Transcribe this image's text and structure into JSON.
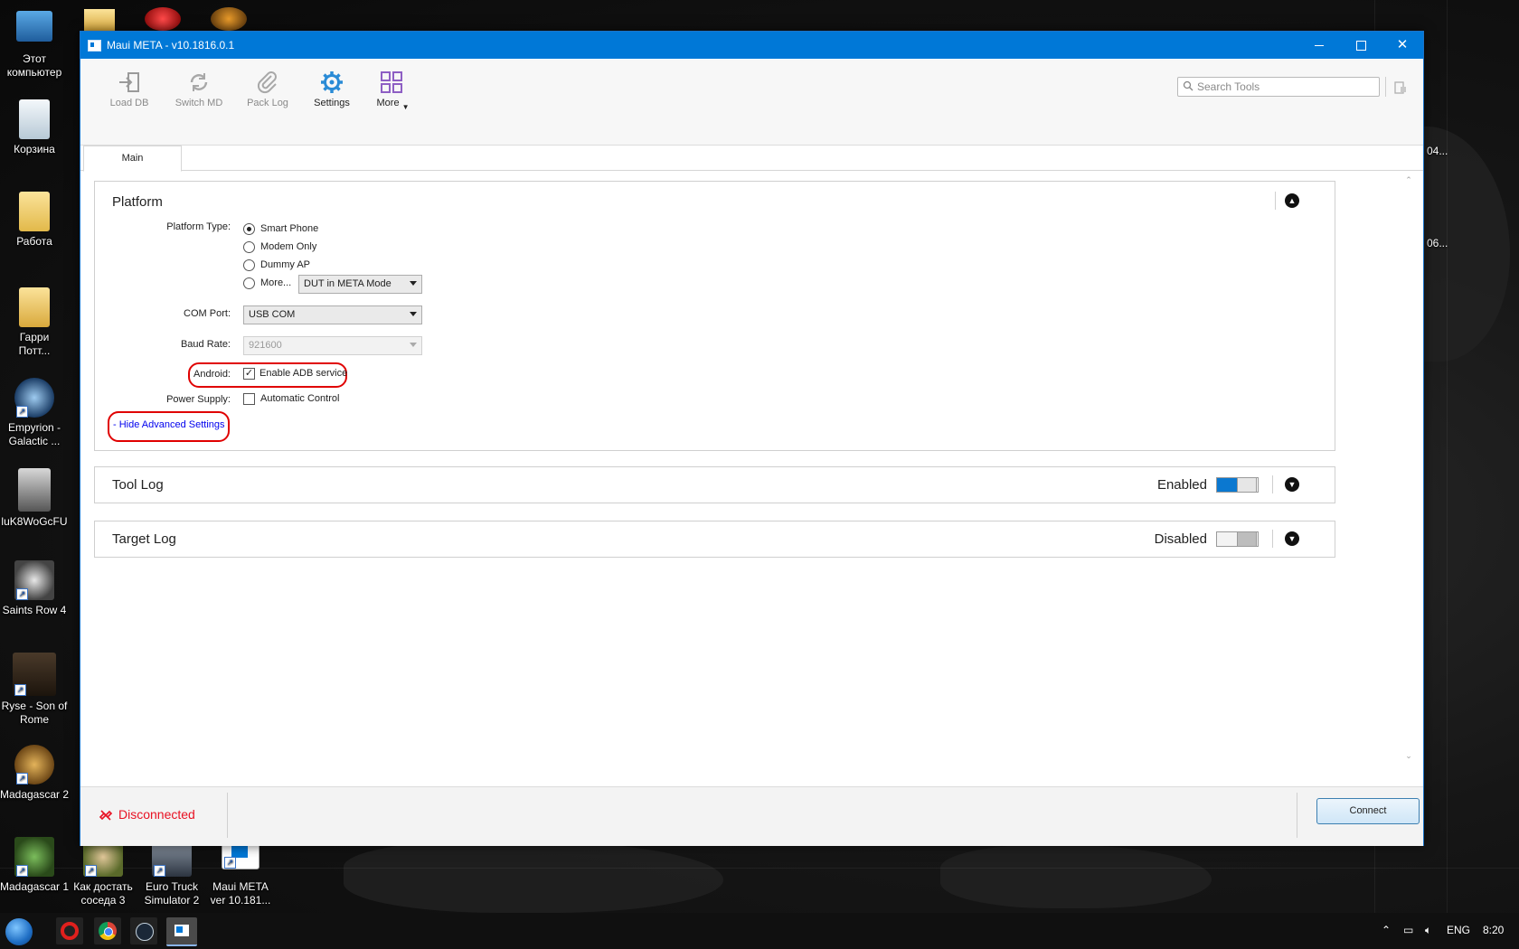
{
  "desktop": {
    "icons": [
      {
        "label": "Этот компьютер"
      },
      {
        "label": "Корзина"
      },
      {
        "label": "Работа"
      },
      {
        "label": "Гарри Потт..."
      },
      {
        "label": "Empyrion - Galactic ..."
      },
      {
        "label": "luK8WoGcFU"
      },
      {
        "label": "Saints Row 4"
      },
      {
        "label": "Ryse - Son of Rome"
      },
      {
        "label": "Madagascar 2"
      },
      {
        "label": "Madagascar 1"
      },
      {
        "label": "Как достать соседа 3"
      },
      {
        "label": "Euro Truck Simulator 2"
      },
      {
        "label": "Maui META ver 10.181..."
      }
    ],
    "right_labels": [
      "04...",
      "06..."
    ]
  },
  "window": {
    "title": "Maui META - v10.1816.0.1"
  },
  "toolbar": {
    "buttons": [
      {
        "label": "Load DB",
        "icon": "load-db-icon"
      },
      {
        "label": "Switch MD",
        "icon": "switch-md-icon"
      },
      {
        "label": "Pack Log",
        "icon": "paperclip-icon"
      },
      {
        "label": "Settings",
        "icon": "gear-icon"
      },
      {
        "label": "More",
        "icon": "grid-icon"
      }
    ],
    "search_placeholder": "Search Tools"
  },
  "tabs": [
    {
      "label": "Main"
    }
  ],
  "platform": {
    "title": "Platform",
    "platform_type_label": "Platform Type:",
    "options": [
      "Smart Phone",
      "Modem Only",
      "Dummy AP",
      "More..."
    ],
    "selected_option": "Smart Phone",
    "more_select": "DUT in META Mode",
    "com_port_label": "COM Port:",
    "com_port_value": "USB COM",
    "baud_rate_label": "Baud Rate:",
    "baud_rate_value": "921600",
    "android_label": "Android:",
    "adb_label": "Enable ADB service",
    "adb_checked": true,
    "power_label": "Power Supply:",
    "power_option": "Automatic Control",
    "power_checked": false,
    "advanced_link": "- Hide Advanced Settings"
  },
  "tool_log": {
    "title": "Tool Log",
    "state": "Enabled",
    "on": true
  },
  "target_log": {
    "title": "Target Log",
    "state": "Disabled",
    "on": false
  },
  "status": {
    "text": "Disconnected",
    "connect_label": "Connect"
  },
  "taskbar": {
    "lang": "ENG",
    "time": "8:20"
  },
  "colors": {
    "accent": "#0078d7",
    "status_red": "#e81123",
    "toggle_on": "#0b78d0",
    "mark": "#e00000"
  }
}
